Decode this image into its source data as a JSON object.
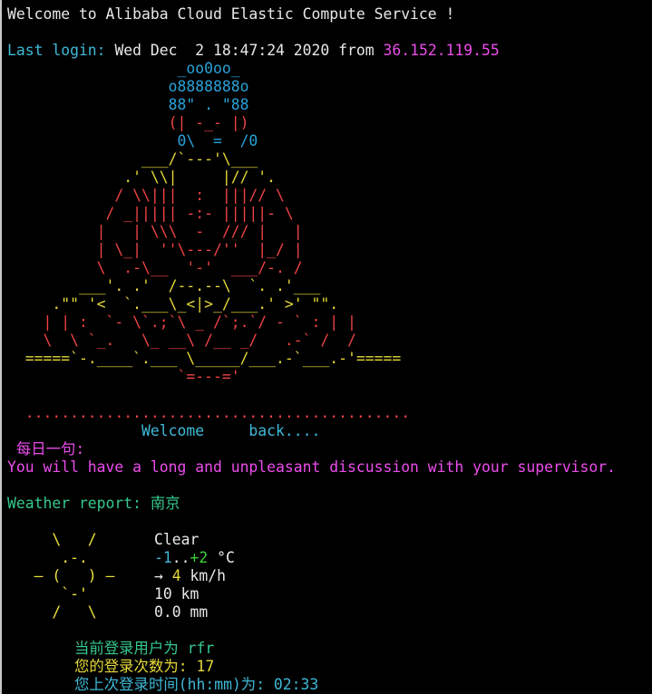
{
  "welcome_line": "Welcome to Alibaba Cloud Elastic Compute Service !",
  "last_login": {
    "label": "Last login:",
    "datetime": "Wed Dec  2 18:47:24 2020 from",
    "ip": "36.152.119.55"
  },
  "ascii_art": {
    "head": [
      "                   _oo0oo_",
      "                  o8888888o",
      "                  88\" . \"88",
      "                  (| -_- |)",
      "                   0\\  =  /0"
    ],
    "chest": [
      "               ___/`---'\\___",
      "             .' \\\\|     |// '."
    ],
    "robe": [
      "            / \\\\|||  :  |||// \\",
      "           / _||||| -:- |||||- \\",
      "          |   | \\\\\\  -  /// |   |",
      "          | \\_|  ''\\---/''  |_/ |",
      "          \\  .-\\__  '-'  ___/-. /"
    ],
    "base": [
      "        ___'. .'  /--.--\\  `. .'___",
      "     .\"\" '<  `.___\\_<|>_/___.' >' \"\".",
      "    | | :  `- \\`.;`\\ _ /`;.`/ - ` : | |",
      "    \\  \\ `_.   \\_ __\\ /__ _/   .-` /  /"
    ],
    "ground": "=====`-.____`.___ \\_____/___.-`___.-'=====",
    "ground_tail": "                   `=---='",
    "dots": "  ...........................................",
    "back": "               Welcome     back...."
  },
  "quote": {
    "label": " 每日一句:",
    "text": "You will have a long and unpleasant discussion with your supervisor."
  },
  "weather": {
    "label": "Weather report:",
    "city": "南京",
    "icon": "sun-icon",
    "icon_lines": [
      "     \\   /    ",
      "      .-.     ",
      "   ― (   ) ―  ",
      "      `-'     ",
      "     /   \\    "
    ],
    "condition": "Clear",
    "temp_low": "-1",
    "temp_sep": "..",
    "temp_high": "+2",
    "temp_unit": " °C",
    "wind_arrow": "→",
    "wind_speed": "4",
    "wind_unit": " km/h",
    "visibility": "10 km",
    "precipitation": "0.0 mm"
  },
  "user_info": {
    "current_user": "当前登录用户为 rfr",
    "login_count": "您的登录次数为: 17",
    "last_login_time": "您上次登录时间(hh:mm)为: 02:33"
  },
  "colors": {
    "background": "#000000",
    "text": "#e8e8e8",
    "cyan": "#3fb9d8",
    "magenta": "#ec4dec",
    "blue": "#29a3da",
    "red": "#ef4343",
    "yellow": "#e5d838",
    "green": "#35c98c"
  }
}
